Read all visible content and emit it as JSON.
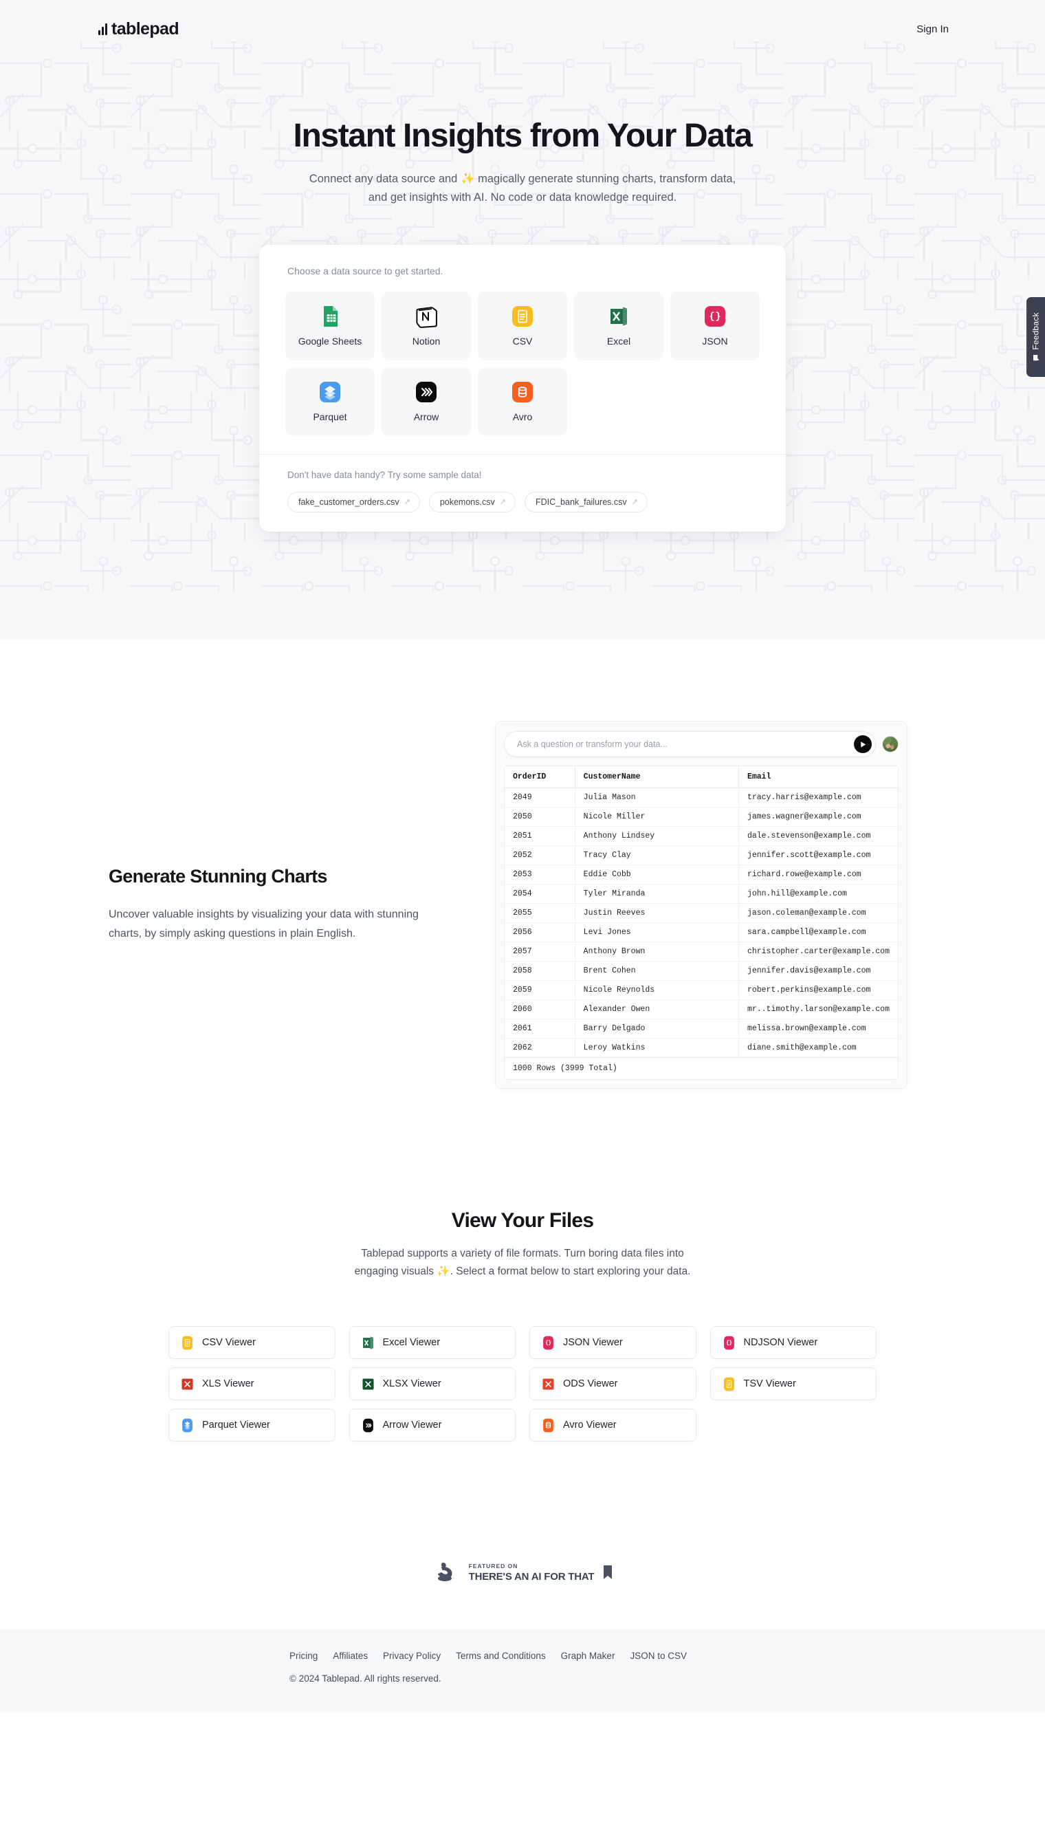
{
  "header": {
    "logo_text": "tablepad",
    "signin_label": "Sign In"
  },
  "hero": {
    "title": "Instant Insights from Your Data",
    "subtitle": "Connect any data source and ✨ magically generate stunning charts, transform data, and get insights with AI. No code or data knowledge required.",
    "card_hint": "Choose a data source to get started.",
    "sources": [
      {
        "label": "Google Sheets",
        "icon": "google-sheets-icon"
      },
      {
        "label": "Notion",
        "icon": "notion-icon"
      },
      {
        "label": "CSV",
        "icon": "csv-icon"
      },
      {
        "label": "Excel",
        "icon": "excel-icon"
      },
      {
        "label": "JSON",
        "icon": "json-icon"
      },
      {
        "label": "Parquet",
        "icon": "parquet-icon"
      },
      {
        "label": "Arrow",
        "icon": "arrow-icon"
      },
      {
        "label": "Avro",
        "icon": "avro-icon"
      }
    ],
    "sample_hint": "Don't have data handy? Try some sample data!",
    "samples": [
      {
        "label": "fake_customer_orders.csv",
        "ext": "↗"
      },
      {
        "label": "pokemons.csv",
        "ext": "↗"
      },
      {
        "label": "FDIC_bank_failures.csv",
        "ext": "↗"
      }
    ]
  },
  "feedback": {
    "label": "Feedback",
    "icon": "speech-bubble-icon"
  },
  "charts_section": {
    "title": "Generate Stunning Charts",
    "body": "Uncover valuable insights by visualizing your data with stunning charts, by simply asking questions in plain English.",
    "ask_placeholder": "Ask a question or transform your data...",
    "ask_value": "",
    "send_icon": "send-icon",
    "avatar": "user-avatar",
    "table": {
      "columns": [
        "OrderID",
        "CustomerName",
        "Email"
      ],
      "rows": [
        [
          "2049",
          "Julia Mason",
          "tracy.harris@example.com"
        ],
        [
          "2050",
          "Nicole Miller",
          "james.wagner@example.com"
        ],
        [
          "2051",
          "Anthony Lindsey",
          "dale.stevenson@example.com"
        ],
        [
          "2052",
          "Tracy Clay",
          "jennifer.scott@example.com"
        ],
        [
          "2053",
          "Eddie Cobb",
          "richard.rowe@example.com"
        ],
        [
          "2054",
          "Tyler Miranda",
          "john.hill@example.com"
        ],
        [
          "2055",
          "Justin Reeves",
          "jason.coleman@example.com"
        ],
        [
          "2056",
          "Levi Jones",
          "sara.campbell@example.com"
        ],
        [
          "2057",
          "Anthony Brown",
          "christopher.carter@example.com"
        ],
        [
          "2058",
          "Brent Cohen",
          "jennifer.davis@example.com"
        ],
        [
          "2059",
          "Nicole Reynolds",
          "robert.perkins@example.com"
        ],
        [
          "2060",
          "Alexander Owen",
          "mr..timothy.larson@example.com"
        ],
        [
          "2061",
          "Barry Delgado",
          "melissa.brown@example.com"
        ],
        [
          "2062",
          "Leroy Watkins",
          "diane.smith@example.com"
        ]
      ],
      "footer": "1000 Rows (3999 Total)"
    }
  },
  "files_section": {
    "title": "View Your Files",
    "subtitle": "Tablepad supports a variety of file formats. Turn boring data files into engaging visuals ✨. Select a format below to start exploring your data.",
    "viewers": [
      {
        "label": "CSV Viewer",
        "icon": "csv-icon"
      },
      {
        "label": "Excel Viewer",
        "icon": "excel-icon"
      },
      {
        "label": "JSON Viewer",
        "icon": "json-icon"
      },
      {
        "label": "NDJSON Viewer",
        "icon": "json-icon"
      },
      {
        "label": "XLS Viewer",
        "icon": "xls-icon"
      },
      {
        "label": "XLSX Viewer",
        "icon": "xlsx-icon"
      },
      {
        "label": "ODS Viewer",
        "icon": "ods-icon"
      },
      {
        "label": "TSV Viewer",
        "icon": "tsv-icon"
      },
      {
        "label": "Parquet Viewer",
        "icon": "parquet-icon"
      },
      {
        "label": "Arrow Viewer",
        "icon": "arrow-icon"
      },
      {
        "label": "Avro Viewer",
        "icon": "avro-icon"
      }
    ]
  },
  "featured_badge": {
    "top_line": "FEATURED ON",
    "bottom_line": "THERE'S AN AI FOR THAT",
    "logo_icon": "flexed-arm-icon",
    "bookmark_icon": "bookmark-icon"
  },
  "footer": {
    "links": [
      "Pricing",
      "Affiliates",
      "Privacy Policy",
      "Terms and Conditions",
      "Graph Maker",
      "JSON to CSV"
    ],
    "copyright": "© 2024 Tablepad. All rights reserved."
  },
  "colors": {
    "hero_bg": "#f7f8fa",
    "text_dark": "#15161a",
    "text_muted": "#4d545e",
    "sheets_green": "#21a366",
    "csv_amber": "#fbbc20",
    "excel_green": "#1e7145",
    "json_pink": "#e0295c",
    "parquet_blue": "#4a9bf0",
    "arrow_black": "#0b0c0e",
    "avro_orange": "#f6601f",
    "xls_red": "#d03a24",
    "feedback_slate": "#3b4150"
  }
}
